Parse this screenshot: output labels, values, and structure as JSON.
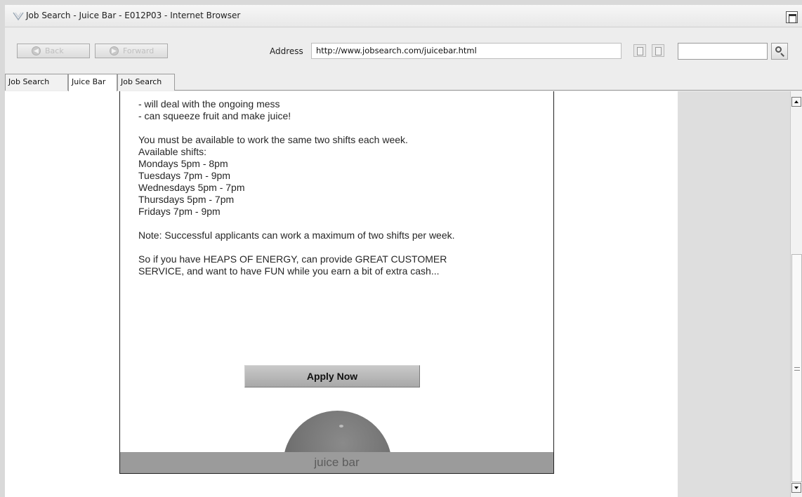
{
  "window": {
    "title": "Job Search - Juice Bar - E012P03 - Internet Browser"
  },
  "toolbar": {
    "back_label": "Back",
    "forward_label": "Forward",
    "address_label": "Address",
    "address_value": "http://www.jobsearch.com/juicebar.html",
    "search_value": ""
  },
  "tabs": [
    {
      "label": "Job Search",
      "active": false
    },
    {
      "label": "Juice Bar",
      "active": true
    },
    {
      "label": "Job Search",
      "active": false
    }
  ],
  "page": {
    "lines_top": [
      "- will deal with the ongoing mess",
      "- can squeeze fruit and make juice!"
    ],
    "availability_lines": [
      "You must be available to work the same two shifts each week.",
      "Available shifts:",
      "Mondays 5pm - 8pm",
      "Tuesdays 7pm - 9pm",
      "Wednesdays 5pm - 7pm",
      "Thursdays 5pm - 7pm",
      "Fridays 7pm - 9pm"
    ],
    "note": "Note: Successful applicants can work a maximum of two shifts per week.",
    "closing_lines": [
      "So if you have HEAPS OF ENERGY, can provide GREAT CUSTOMER",
      "SERVICE, and want to have FUN while you earn a bit of extra cash..."
    ],
    "apply_button": "Apply Now",
    "footer_text": "juice bar"
  },
  "colors": {
    "footer_bar": "#9b9b9b",
    "right_gutter": "#dedede"
  },
  "icons": {
    "app": "app-logo-icon",
    "back": "back-arrow-icon",
    "forward": "forward-arrow-icon",
    "copy": "copy-icon",
    "paste": "paste-icon",
    "search": "search-icon",
    "maximize": "maximize-icon",
    "scroll_up": "scroll-up-arrow-icon",
    "scroll_down": "scroll-down-arrow-icon"
  }
}
